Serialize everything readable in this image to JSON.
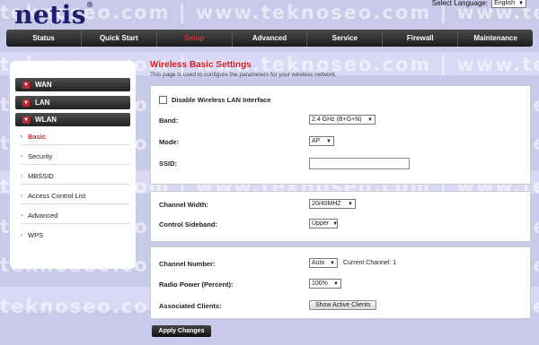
{
  "brand": {
    "name": "netis",
    "reg": "®"
  },
  "watermark": "teknoseo.com | www.teknoseo.com | www.teknos",
  "language": {
    "label": "Select Language:",
    "value": "English"
  },
  "nav": [
    "Status",
    "Quick Start",
    "Setup",
    "Advanced",
    "Service",
    "Firewall",
    "Maintenance"
  ],
  "nav_active": "Setup",
  "sidebar": {
    "groups": [
      "WAN",
      "LAN",
      "WLAN"
    ],
    "items": [
      "Basic",
      "Security",
      "MBSSID",
      "Access Control List",
      "Advanced",
      "WPS"
    ],
    "active": "Basic"
  },
  "page": {
    "title": "Wireless Basic Settings",
    "subtitle": "This page is used to configure the parameters for your wireless network."
  },
  "form": {
    "disable_label": "Disable Wireless LAN Interface",
    "band_label": "Band:",
    "band_value": "2.4 GHz (B+G+N)",
    "mode_label": "Mode:",
    "mode_value": "AP",
    "ssid_label": "SSID:",
    "ssid_value": "",
    "width_label": "Channel Width:",
    "width_value": "20/40MHZ",
    "sideband_label": "Control Sideband:",
    "sideband_value": "Upper",
    "channel_label": "Channel Number:",
    "channel_value": "Auto",
    "current_channel": "Current Channel: 1",
    "power_label": "Radio Power (Percent):",
    "power_value": "100%",
    "clients_label": "Associated Clients:",
    "clients_button": "Show Active Clients",
    "apply_button": "Apply Changes"
  },
  "colors": {
    "accent": "#d32027",
    "nav_dark": "#222222",
    "background": "#c9c9ea"
  }
}
